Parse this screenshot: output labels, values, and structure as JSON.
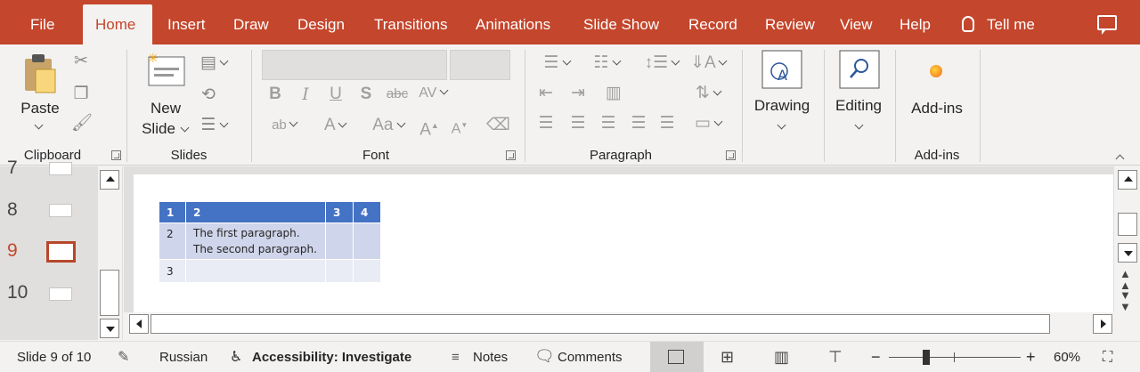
{
  "tabs": [
    {
      "label": "File"
    },
    {
      "label": "Home"
    },
    {
      "label": "Insert"
    },
    {
      "label": "Draw"
    },
    {
      "label": "Design"
    },
    {
      "label": "Transitions"
    },
    {
      "label": "Animations"
    },
    {
      "label": "Slide Show"
    },
    {
      "label": "Record"
    },
    {
      "label": "Review"
    },
    {
      "label": "View"
    },
    {
      "label": "Help"
    }
  ],
  "active_tab": "Home",
  "tell_me": "Tell me",
  "ribbon": {
    "clipboard": {
      "paste": "Paste",
      "label": "Clipboard"
    },
    "slides": {
      "new_slide_line1": "New",
      "new_slide_line2": "Slide",
      "label": "Slides"
    },
    "font": {
      "label": "Font"
    },
    "paragraph": {
      "label": "Paragraph"
    },
    "drawing": {
      "label": "Drawing"
    },
    "editing": {
      "label": "Editing"
    },
    "addins": {
      "button": "Add-ins",
      "label": "Add-ins"
    }
  },
  "thumbnails": [
    {
      "num": "7"
    },
    {
      "num": "8"
    },
    {
      "num": "9"
    },
    {
      "num": "10"
    }
  ],
  "current_slide_index": 2,
  "table": {
    "header": [
      "1",
      "2",
      "3",
      "4"
    ],
    "row1": {
      "c1": "2",
      "line1": "The first paragraph.",
      "line2": "The second paragraph.",
      "c3": "",
      "c4": ""
    },
    "row2": {
      "c1": "3",
      "c2": "",
      "c3": "",
      "c4": ""
    }
  },
  "status": {
    "slide_info": "Slide 9 of 10",
    "language": "Russian",
    "accessibility": "Accessibility: Investigate",
    "notes": "Notes",
    "comments": "Comments",
    "zoom_minus": "−",
    "zoom_plus": "+",
    "zoom": "60%"
  },
  "colors": {
    "accent": "#c4462c",
    "table_header": "#4472c4",
    "table_band": "#cfd5ea"
  }
}
